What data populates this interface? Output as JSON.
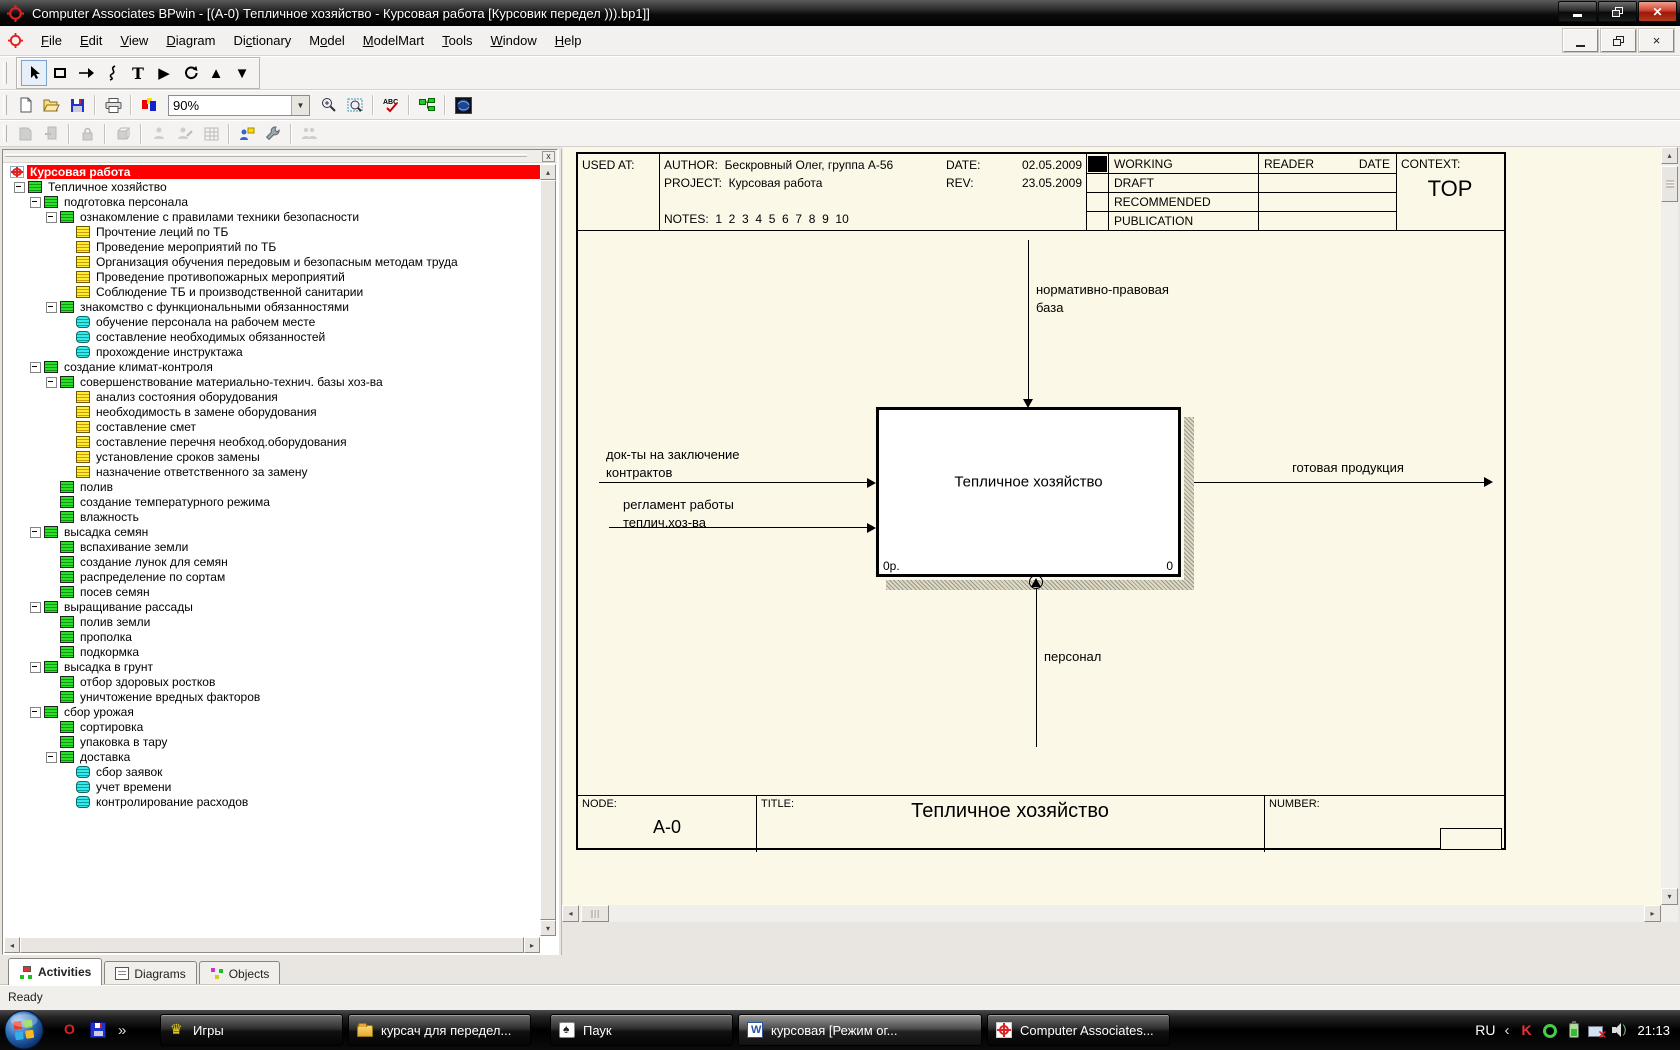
{
  "window": {
    "title": "Computer Associates BPwin - [(А-0) Тепличное хозяйство - Курсовая работа  [Курсовик передел ))).bp1]]"
  },
  "menu": {
    "items": [
      {
        "pre": "",
        "u": "F",
        "post": "ile"
      },
      {
        "pre": "",
        "u": "E",
        "post": "dit"
      },
      {
        "pre": "",
        "u": "V",
        "post": "iew"
      },
      {
        "pre": "",
        "u": "D",
        "post": "iagram"
      },
      {
        "pre": "Di",
        "u": "c",
        "post": "tionary"
      },
      {
        "pre": "M",
        "u": "o",
        "post": "del"
      },
      {
        "pre": "",
        "u": "M",
        "post": "odelMart"
      },
      {
        "pre": "",
        "u": "T",
        "post": "ools"
      },
      {
        "pre": "",
        "u": "W",
        "post": "indow"
      },
      {
        "pre": "",
        "u": "H",
        "post": "elp"
      }
    ]
  },
  "toolbar": {
    "zoom": "90%",
    "tools": [
      "pointer-tool",
      "activity-box-tool",
      "arrow-tool",
      "squiggle-tool",
      "text-tool",
      "go-child-tool",
      "redraw-tool",
      "go-up-tool",
      "go-down-tool"
    ],
    "standard": [
      "new-icon",
      "open-icon",
      "save-icon",
      "print-icon",
      "color-icon",
      "zoom-combo",
      "zoom-in-icon",
      "zoom-fit-icon",
      "spellcheck-icon",
      "model-explorer-icon",
      "web-icon"
    ],
    "modelmart": [
      "merge-icon",
      "split-icon",
      "lock-icon",
      "version-icon",
      "user-icon",
      "user-edit-icon",
      "grid-icon",
      "user-properties-icon",
      "admin-wrench-icon",
      "users-icon"
    ]
  },
  "tree": {
    "items": [
      {
        "label": "Курсовая работа",
        "cls": "ind0 sel",
        "icon": "bpwin-node-icon",
        "exp": "exp-none"
      },
      {
        "label": "Тепличное хозяйство",
        "cls": "ind1",
        "icon": "activity-green-icon",
        "exp": "exp-minus"
      },
      {
        "label": "подготовка персонала",
        "cls": "ind2",
        "icon": "activity-green-icon",
        "exp": "exp-minus"
      },
      {
        "label": "ознакомление с правилами техники безопасности",
        "cls": "ind3",
        "icon": "activity-green-icon",
        "exp": "exp-minus"
      },
      {
        "label": "Прочтение леций  по ТБ",
        "cls": "ind4",
        "icon": "activity-yellow-icon",
        "exp": "exp-blank"
      },
      {
        "label": "Проведение мероприятий по ТБ",
        "cls": "ind4",
        "icon": "activity-yellow-icon",
        "exp": "exp-blank"
      },
      {
        "label": "Организация обучения  передовым и безопасным методам труда",
        "cls": "ind4",
        "icon": "activity-yellow-icon",
        "exp": "exp-blank"
      },
      {
        "label": "Проведение  противопожарных мероприятий",
        "cls": "ind4",
        "icon": "activity-yellow-icon",
        "exp": "exp-blank"
      },
      {
        "label": "Соблюдение ТБ  и  производственной  санитарии",
        "cls": "ind4",
        "icon": "activity-yellow-icon",
        "exp": "exp-blank"
      },
      {
        "label": "знакомство с  функциональными обязанностями",
        "cls": "ind3",
        "icon": "activity-green-icon",
        "exp": "exp-minus"
      },
      {
        "label": "обучение персонала на рабочем месте",
        "cls": "ind4",
        "icon": "activity-cyan-icon",
        "exp": "exp-blank"
      },
      {
        "label": "составление необходимых обязанностей",
        "cls": "ind4",
        "icon": "activity-cyan-icon",
        "exp": "exp-blank"
      },
      {
        "label": "прохождение инструктажа",
        "cls": "ind4",
        "icon": "activity-cyan-icon",
        "exp": "exp-blank"
      },
      {
        "label": "создание климат-контроля",
        "cls": "ind2",
        "icon": "activity-green-icon",
        "exp": "exp-minus"
      },
      {
        "label": "совершенствование  материально-технич. базы хоз-ва",
        "cls": "ind3",
        "icon": "activity-green-icon",
        "exp": "exp-minus"
      },
      {
        "label": "анализ состояния оборудования",
        "cls": "ind4",
        "icon": "activity-yellow-icon",
        "exp": "exp-blank"
      },
      {
        "label": "необходимость в замене оборудования",
        "cls": "ind4",
        "icon": "activity-yellow-icon",
        "exp": "exp-blank"
      },
      {
        "label": "составление смет",
        "cls": "ind4",
        "icon": "activity-yellow-icon",
        "exp": "exp-blank"
      },
      {
        "label": "составление перечня необход.оборудования",
        "cls": "ind4",
        "icon": "activity-yellow-icon",
        "exp": "exp-blank"
      },
      {
        "label": "установление сроков замены",
        "cls": "ind4",
        "icon": "activity-yellow-icon",
        "exp": "exp-blank"
      },
      {
        "label": "назначение ответственного за замену",
        "cls": "ind4",
        "icon": "activity-yellow-icon",
        "exp": "exp-blank"
      },
      {
        "label": "полив",
        "cls": "ind3",
        "icon": "activity-green-icon",
        "exp": "exp-blank"
      },
      {
        "label": "создание  температурного режима",
        "cls": "ind3",
        "icon": "activity-green-icon",
        "exp": "exp-blank"
      },
      {
        "label": "влажность",
        "cls": "ind3",
        "icon": "activity-green-icon",
        "exp": "exp-blank"
      },
      {
        "label": "высадка семян",
        "cls": "ind2",
        "icon": "activity-green-icon",
        "exp": "exp-minus"
      },
      {
        "label": "вспахивание земли",
        "cls": "ind3",
        "icon": "activity-green-icon",
        "exp": "exp-blank"
      },
      {
        "label": "создание лунок  для семян",
        "cls": "ind3",
        "icon": "activity-green-icon",
        "exp": "exp-blank"
      },
      {
        "label": "распределение  по сортам",
        "cls": "ind3",
        "icon": "activity-green-icon",
        "exp": "exp-blank"
      },
      {
        "label": "посев семян",
        "cls": "ind3",
        "icon": "activity-green-icon",
        "exp": "exp-blank"
      },
      {
        "label": "выращивание рассады",
        "cls": "ind2",
        "icon": "activity-green-icon",
        "exp": "exp-minus"
      },
      {
        "label": "полив земли",
        "cls": "ind3",
        "icon": "activity-green-icon",
        "exp": "exp-blank"
      },
      {
        "label": "прополка",
        "cls": "ind3",
        "icon": "activity-green-icon",
        "exp": "exp-blank"
      },
      {
        "label": "подкормка",
        "cls": "ind3",
        "icon": "activity-green-icon",
        "exp": "exp-blank"
      },
      {
        "label": "высадка в грунт",
        "cls": "ind2",
        "icon": "activity-green-icon",
        "exp": "exp-minus"
      },
      {
        "label": "отбор здоровых ростков",
        "cls": "ind3",
        "icon": "activity-green-icon",
        "exp": "exp-blank"
      },
      {
        "label": "уничтожение вредных  факторов",
        "cls": "ind3",
        "icon": "activity-green-icon",
        "exp": "exp-blank"
      },
      {
        "label": "сбор урожая",
        "cls": "ind2",
        "icon": "activity-green-icon",
        "exp": "exp-minus"
      },
      {
        "label": "сортировка",
        "cls": "ind3",
        "icon": "activity-green-icon",
        "exp": "exp-blank"
      },
      {
        "label": "упаковка в тару",
        "cls": "ind3",
        "icon": "activity-green-icon",
        "exp": "exp-blank"
      },
      {
        "label": "доставка",
        "cls": "ind3",
        "icon": "activity-green-icon",
        "exp": "exp-minus"
      },
      {
        "label": "сбор заявок",
        "cls": "ind4",
        "icon": "activity-cyan-icon",
        "exp": "exp-blank"
      },
      {
        "label": "учет времени",
        "cls": "ind4",
        "icon": "activity-cyan-icon",
        "exp": "exp-blank"
      },
      {
        "label": "контролирование расходов",
        "cls": "ind4",
        "icon": "activity-cyan-icon",
        "exp": "exp-blank"
      }
    ]
  },
  "tabs": {
    "items": [
      {
        "label": "Activities",
        "cls": "active",
        "icon": "activities-icon"
      },
      {
        "label": "Diagrams",
        "cls": "",
        "icon": "diagrams-icon"
      },
      {
        "label": "Objects",
        "cls": "",
        "icon": "objects-icon"
      }
    ]
  },
  "status_bar": {
    "text": "Ready"
  },
  "diagram": {
    "header": {
      "used_at": "USED AT:",
      "author": "AUTHOR:  Бескровный Олег, группа А-56",
      "project": "PROJECT:  Курсовая работа",
      "notes": "NOTES:  1  2  3  4  5  6  7  8  9  10",
      "date_label": "DATE:",
      "date": "02.05.2009",
      "rev_label": "REV:",
      "rev": "23.05.2009",
      "statuses": [
        "WORKING",
        "DRAFT",
        "RECOMMENDED",
        "PUBLICATION"
      ],
      "reader_label": "READER",
      "reader_date_label": "DATE",
      "context_label": "CONTEXT:",
      "context": "TOP"
    },
    "box": {
      "title": "Тепличное хозяйство",
      "cost": "0р.",
      "node_num": "0"
    },
    "arrows": {
      "control_line1": "нормативно-правовая",
      "control_line2": "база",
      "input1_line1": "док-ты на заключение",
      "input1_line2": "контрактов",
      "input2_line1": "регламент работы",
      "input2_line2": "теплич.хоз-ва",
      "output": "готовая продукция",
      "mechanism": "персонал"
    },
    "footer": {
      "node_label": "NODE:",
      "node": "A-0",
      "title_label": "TITLE:",
      "title": "Тепличное хозяйство",
      "number_label": "NUMBER:"
    }
  },
  "taskbar": {
    "buttons": [
      {
        "label": "Игры",
        "icon": "games-icon",
        "cls": ""
      },
      {
        "label": "курсач для передел...",
        "icon": "folder-icon",
        "cls": ""
      },
      {
        "label": "Паук",
        "icon": "spider-icon",
        "cls": ""
      },
      {
        "label": "курсовая [Режим ог...",
        "icon": "word-icon",
        "cls": ""
      },
      {
        "label": "Computer Associates...",
        "icon": "bpwin-icon",
        "cls": "active"
      }
    ],
    "quick_launch": [
      "opera-icon",
      "saveql-icon"
    ],
    "tray": {
      "lang": "RU",
      "time": "21:13",
      "icons": [
        "kaspersky-icon",
        "updater-icon",
        "battery-icon",
        "network-icon",
        "volume-icon"
      ]
    }
  },
  "colors": {
    "selection": "#ff0000",
    "sheet": "#fcf8e8",
    "taskbar": "#000000",
    "activity_green": "#2ae02a",
    "activity_yellow": "#ffee33",
    "activity_cyan": "#35eaea"
  }
}
